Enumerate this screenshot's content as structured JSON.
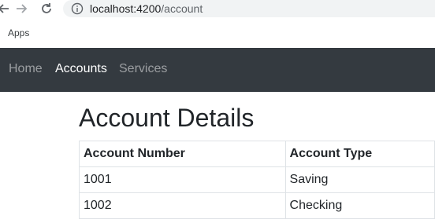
{
  "browser": {
    "url_host": "localhost:4200",
    "url_path": "/account",
    "bookmarks": [
      "Apps"
    ]
  },
  "navbar": {
    "links": [
      {
        "label": "Home",
        "active": false
      },
      {
        "label": "Accounts",
        "active": true
      },
      {
        "label": "Services",
        "active": false
      }
    ]
  },
  "page": {
    "title": "Account Details",
    "table": {
      "headers": [
        "Account Number",
        "Account Type"
      ],
      "rows": [
        [
          "1001",
          "Saving"
        ],
        [
          "1002",
          "Checking"
        ]
      ]
    }
  },
  "colors": {
    "navbar_bg": "#343a40",
    "nav_link_active": "#ffffff",
    "nav_link_inactive": "rgba(255,255,255,0.5)",
    "table_border": "#dee2e6",
    "omnibox_bg": "#f1f3f4"
  },
  "icons": {
    "back": "back-arrow-icon",
    "forward": "forward-arrow-icon",
    "reload": "reload-icon",
    "site_info": "info-icon"
  }
}
